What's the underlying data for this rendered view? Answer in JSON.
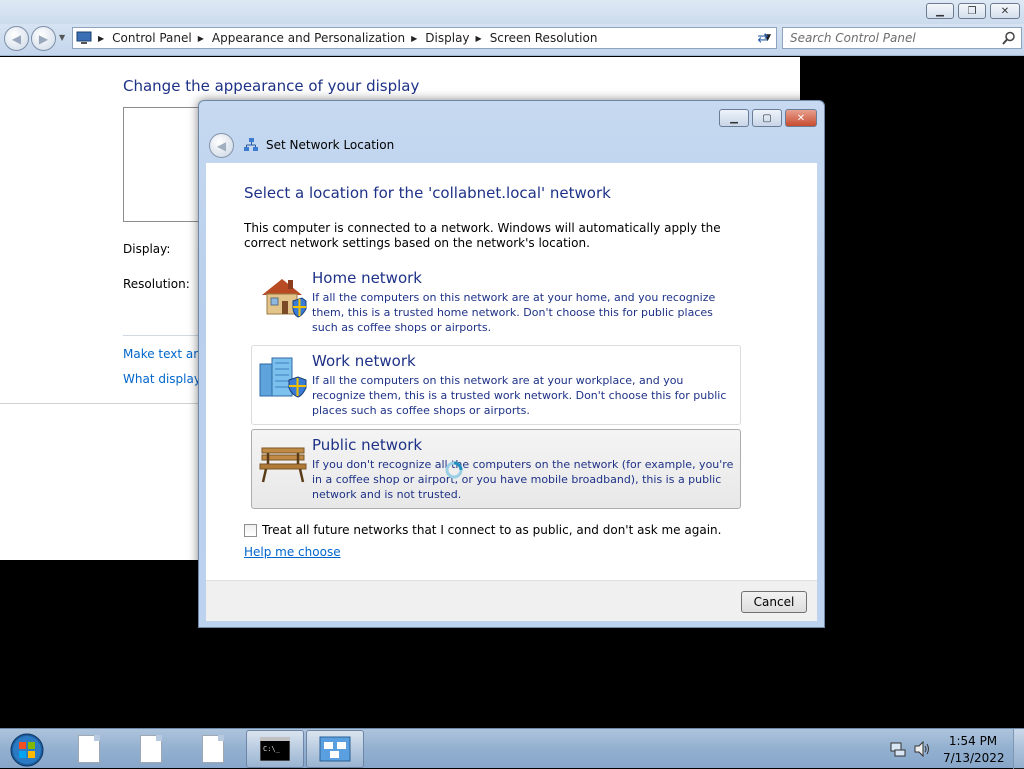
{
  "control_panel": {
    "breadcrumb": [
      "Control Panel",
      "Appearance and Personalization",
      "Display",
      "Screen Resolution"
    ],
    "search_placeholder": "Search Control Panel",
    "page_title": "Change the appearance of your display",
    "display_label": "Display:",
    "resolution_label": "Resolution:",
    "link_make_text": "Make text and",
    "link_display_settings": "What display s"
  },
  "dialog": {
    "window_title": "Set Network Location",
    "heading": "Select a location for the 'collabnet.local' network",
    "intro": "This computer is connected to a network. Windows will automatically apply the correct network settings based on the network's location.",
    "options": [
      {
        "title": "Home network",
        "description": "If all the computers on this network are at your home, and you recognize them, this is a trusted home network.  Don't choose this for public places such as coffee shops or airports.",
        "icon": "home-network-icon"
      },
      {
        "title": "Work network",
        "description": "If all the computers on this network are at your workplace, and you recognize them, this is a trusted work network.  Don't choose this for public places such as coffee shops or airports.",
        "icon": "work-network-icon"
      },
      {
        "title": "Public network",
        "description": "If you don't recognize all the computers on the network (for example, you're in a coffee shop or airport, or you have mobile broadband), this is a public network and is not trusted.",
        "icon": "public-network-bench-icon"
      }
    ],
    "checkbox_label": "Treat all future networks that I connect to as public, and don't ask me again.",
    "checkbox_checked": false,
    "help_link": "Help me choose",
    "cancel_label": "Cancel"
  },
  "taskbar": {
    "time": "1:54 PM",
    "date": "7/13/2022",
    "items": [
      "file-icon",
      "file-icon",
      "file-icon",
      "command-prompt-icon",
      "network-location-icon"
    ]
  },
  "colors": {
    "heading_blue": "#1e3287",
    "link_blue": "#0066cc",
    "taskbar": "#93b0d0"
  }
}
